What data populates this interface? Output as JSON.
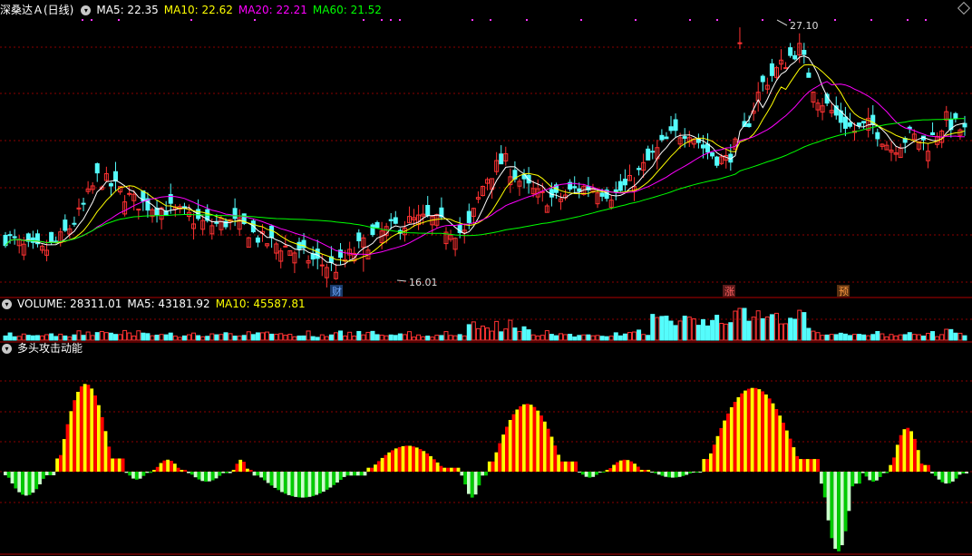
{
  "panels": {
    "price": {
      "title": "深桑达Ａ(日线)",
      "ma_labels": [
        {
          "text": "MA5: 22.35",
          "color": "#ffffff"
        },
        {
          "text": "MA10: 22.62",
          "color": "#ffff00"
        },
        {
          "text": "MA20: 22.21",
          "color": "#ff00ff"
        },
        {
          "text": "MA60: 21.52",
          "color": "#00ff00"
        }
      ],
      "high_marker": "27.10",
      "low_marker": "16.01",
      "event_badges": [
        "财",
        "涨",
        "预"
      ]
    },
    "volume": {
      "labels": [
        {
          "text": "VOLUME: 28311.01",
          "color": "#ffffff"
        },
        {
          "text": "MA5: 43181.92",
          "color": "#ffffff"
        },
        {
          "text": "MA10: 45587.81",
          "color": "#ffff00"
        }
      ]
    },
    "indicator": {
      "title": "多头攻击动能"
    }
  },
  "colors": {
    "up": "#ff3232",
    "down": "#54fcfc",
    "grid": "#8b0000",
    "osc_up_light": "#ffff00",
    "osc_up_dark": "#ff0000",
    "osc_down_light": "#ccffcc",
    "osc_down_dark": "#00cc00"
  },
  "chart_data": [
    {
      "type": "candlestick",
      "title": "深桑达Ａ(日线)",
      "marked_high": 27.1,
      "marked_low": 16.01,
      "series": [
        {
          "name": "MA5",
          "last": 22.35
        },
        {
          "name": "MA10",
          "last": 22.62
        },
        {
          "name": "MA20",
          "last": 22.21
        },
        {
          "name": "MA60",
          "last": 21.52
        }
      ],
      "close_path": [
        17.6,
        17.1,
        16.9,
        17.5,
        18.6,
        20.3,
        19.8,
        19.2,
        19.0,
        18.8,
        18.5,
        18.1,
        18.3,
        18.0,
        17.4,
        17.2,
        16.8,
        16.4,
        16.2,
        17.0,
        17.6,
        18.0,
        18.3,
        18.4,
        18.0,
        17.7,
        20.2,
        21.1,
        20.0,
        19.4,
        19.3,
        19.8,
        19.9,
        19.5,
        20.1,
        21.2,
        22.1,
        22.5,
        21.5,
        21.0,
        22.2,
        24.5,
        25.3,
        26.2,
        24.0,
        23.1,
        22.4,
        22.7,
        21.6,
        22.2,
        21.8,
        22.9,
        22.35
      ]
    },
    {
      "type": "bar",
      "title": "VOLUME",
      "series": [
        {
          "name": "VOLUME",
          "last": 28311.01
        },
        {
          "name": "MA5",
          "last": 43181.92
        },
        {
          "name": "MA10",
          "last": 45587.81
        }
      ]
    },
    {
      "type": "bar",
      "title": "多头攻击动能",
      "segments": [
        {
          "from": 0,
          "to": 14,
          "peak": -1.2
        },
        {
          "from": 15,
          "to": 34,
          "peak": 4.4
        },
        {
          "from": 35,
          "to": 42,
          "peak": -0.4
        },
        {
          "from": 43,
          "to": 52,
          "peak": 0.6
        },
        {
          "from": 53,
          "to": 65,
          "peak": -0.5
        },
        {
          "from": 66,
          "to": 71,
          "peak": 0.6
        },
        {
          "from": 72,
          "to": 104,
          "peak": -1.3
        },
        {
          "from": 105,
          "to": 131,
          "peak": 1.3
        },
        {
          "from": 132,
          "to": 139,
          "peak": -1.3
        },
        {
          "from": 140,
          "to": 165,
          "peak": 3.4
        },
        {
          "from": 166,
          "to": 173,
          "peak": -0.3
        },
        {
          "from": 174,
          "to": 186,
          "peak": 0.6
        },
        {
          "from": 187,
          "to": 201,
          "peak": -0.3
        },
        {
          "from": 202,
          "to": 235,
          "peak": 4.2
        },
        {
          "from": 236,
          "to": 247,
          "peak": -4.0
        },
        {
          "from": 248,
          "to": 255,
          "peak": -0.5
        },
        {
          "from": 256,
          "to": 267,
          "peak": 2.2
        },
        {
          "from": 268,
          "to": 278,
          "peak": -0.6
        }
      ]
    }
  ]
}
